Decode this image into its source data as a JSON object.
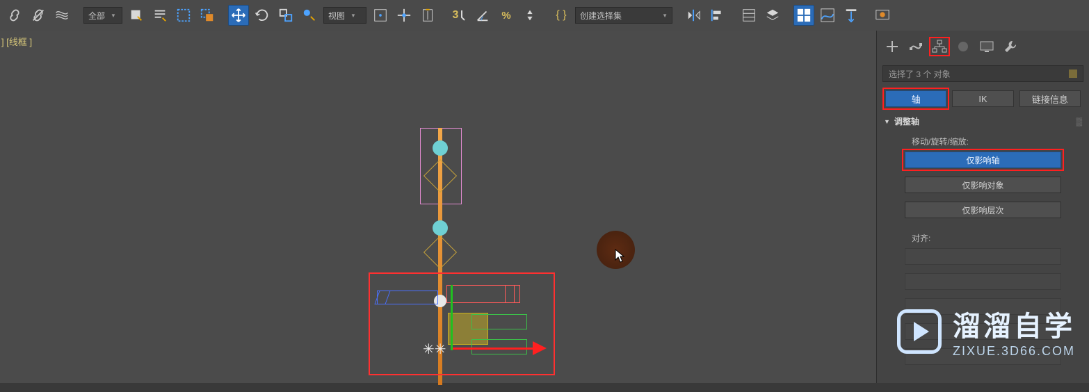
{
  "toolbar": {
    "filter_dropdown": "全部",
    "view_dropdown": "视图",
    "set_dropdown": "创建选择集",
    "icons": {
      "link": "link-icon",
      "unlink": "unlink-icon",
      "bind": "bind-space-warp-icon",
      "select_filter": "selection-filter-dropdown",
      "select_object": "select-object-icon",
      "select_by_name": "select-by-name-icon",
      "select_rect": "rectangular-selection-icon",
      "select_window": "window-crossing-icon",
      "move": "move-icon",
      "rotate": "rotate-icon",
      "scale": "scale-icon",
      "place": "placement-icon",
      "ref_coord": "reference-coord-dropdown",
      "use_pivot": "use-pivot-icon",
      "use_center": "use-center-icon",
      "manip": "manipulate-icon",
      "snap3d": "snap-3-icon",
      "angle_snap": "angle-snap-icon",
      "percent_snap": "percent-snap-icon",
      "spinner_snap": "spinner-snap-icon",
      "edit_set": "edit-named-sets-icon",
      "named_set": "named-selection-set-dropdown",
      "mirror": "mirror-icon",
      "align": "align-icon",
      "layers": "layer-explorer-icon",
      "toggle_ribbon": "toggle-ribbon-icon",
      "curve_editor": "curve-editor-icon",
      "schematic": "schematic-view-icon",
      "material": "material-editor-icon",
      "render_setup": "render-setup-icon",
      "render_frame": "render-frame-icon"
    }
  },
  "viewport": {
    "label": "] [线框 ]"
  },
  "right_panel": {
    "selection_info": "选择了 3 个 对象",
    "tabs": {
      "create": "create-tab-icon",
      "modify": "modify-tab-icon",
      "hierarchy": "hierarchy-tab-icon",
      "motion": "motion-tab-icon",
      "display": "display-tab-icon",
      "utilities": "utilities-tab-icon"
    },
    "cat_buttons": {
      "pivot": "轴",
      "ik": "IK",
      "link_info": "链接信息"
    },
    "section_title": "调整轴",
    "move_rot_scale_label": "移动/旋转/缩放:",
    "affect_pivot": "仅影响轴",
    "affect_object": "仅影响对象",
    "affect_hierarchy": "仅影响层次",
    "align_label": "对齐:"
  },
  "watermark": {
    "line1": "溜溜自学",
    "line2": "ZIXUE.3D66.COM"
  }
}
